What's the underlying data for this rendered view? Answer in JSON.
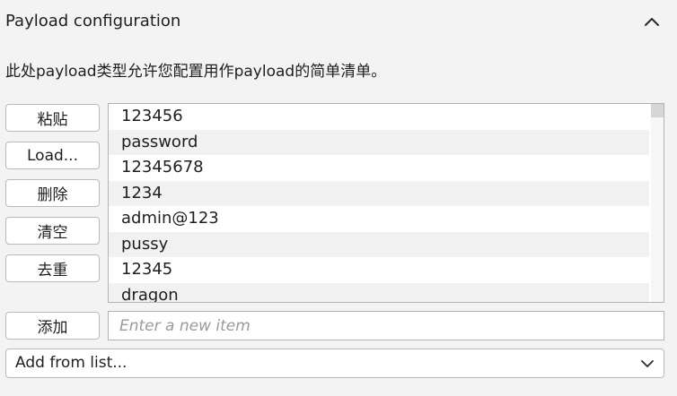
{
  "section": {
    "title": "Payload configuration",
    "description": "此处payload类型允许您配置用作payload的简单清单。"
  },
  "buttons": {
    "paste": "粘贴",
    "load": "Load...",
    "remove": "删除",
    "clear": "清空",
    "deduplicate": "去重",
    "add": "添加"
  },
  "payload_list": {
    "items": [
      "123456",
      "password",
      "12345678",
      "1234",
      "admin@123",
      "pussy",
      "12345",
      "dragon"
    ]
  },
  "new_item": {
    "placeholder": "Enter a new item",
    "value": ""
  },
  "add_from_list": {
    "selected": "Add from list..."
  },
  "icons": {
    "collapse": "chevron-up-icon",
    "dropdown": "chevron-down-icon"
  }
}
